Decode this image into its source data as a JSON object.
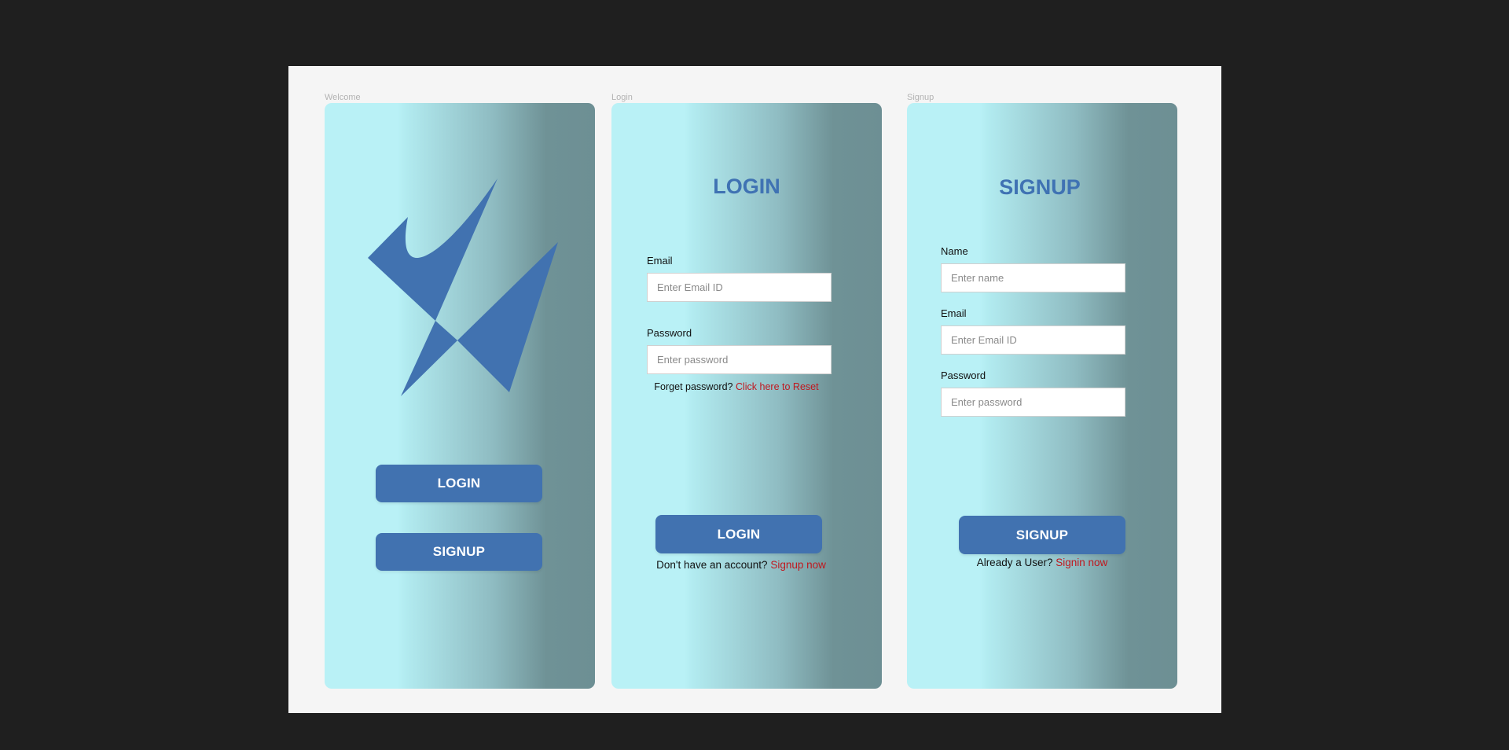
{
  "frames": {
    "welcome": {
      "label": "Welcome",
      "login_button": "LOGIN",
      "signup_button": "SIGNUP"
    },
    "login": {
      "label": "Login",
      "title": "LOGIN",
      "email_label": "Email",
      "email_placeholder": "Enter Email ID",
      "password_label": "Password",
      "password_placeholder": "Enter password",
      "forgot_text": "Forget password?",
      "forgot_link": "Click here to Reset",
      "button": "LOGIN",
      "no_account_text": "Don't have an account?",
      "signup_link": "Signup now"
    },
    "signup": {
      "label": "Signup",
      "title": "SIGNUP",
      "name_label": "Name",
      "name_placeholder": "Enter name",
      "email_label": "Email",
      "email_placeholder": "Enter Email ID",
      "password_label": "Password",
      "password_placeholder": "Enter password",
      "button": "SIGNUP",
      "existing_user_text": "Already a User?",
      "signin_link": "Signin now"
    }
  },
  "icons": {
    "logo": "abstract-check-logo-icon"
  },
  "colors": {
    "accent": "#4172b0",
    "link": "#c0171e",
    "gradient_light": "#b9f1f6",
    "gradient_dark": "#6d8f94",
    "app_background": "#1f1f1f",
    "canvas_background": "#f5f5f5"
  }
}
